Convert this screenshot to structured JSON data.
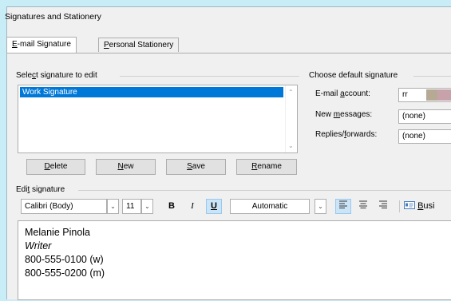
{
  "window": {
    "title": "Signatures and Stationery"
  },
  "tabs": [
    {
      "label": "E-mail Signature",
      "underline": "E",
      "rest": "-mail Signature"
    },
    {
      "label": "Personal Stationery",
      "underline": "P",
      "rest": "ersonal Stationery"
    }
  ],
  "select_section": {
    "label_pre": "Sele",
    "label_u": "c",
    "label_post": "t signature to edit",
    "items": [
      "Work Signature"
    ]
  },
  "buttons": {
    "delete": {
      "u": "D",
      "rest": "elete"
    },
    "new": {
      "u": "N",
      "rest": "ew"
    },
    "save": {
      "u": "S",
      "rest": "ave"
    },
    "rename": {
      "u": "R",
      "rest": "ename"
    }
  },
  "defaults": {
    "header": "Choose default signature",
    "email_label_pre": "E-mail ",
    "email_label_u": "a",
    "email_label_post": "ccount:",
    "email_value": "rr",
    "new_label_pre": "New ",
    "new_label_u": "m",
    "new_label_post": "essages:",
    "new_value": "(none)",
    "replies_label_pre": "Replies/",
    "replies_label_u": "f",
    "replies_label_post": "orwards:",
    "replies_value": "(none)"
  },
  "edit_section": {
    "label_pre": "Edi",
    "label_u": "t",
    "label_post": " signature"
  },
  "toolbar": {
    "font": "Calibri (Body)",
    "size": "11",
    "bold": "B",
    "italic": "I",
    "underline": "U",
    "color": "Automatic",
    "business_u": "B",
    "business_rest": "usi"
  },
  "signature_lines": {
    "name": "Melanie Pinola",
    "title": "Writer",
    "phone_work": "800-555-0100 (w)",
    "phone_mobile": "800-555-0200 (m)"
  },
  "colors": {
    "selection": "#0078d7",
    "toggle_on": "#cce4f7",
    "backdrop": "#c9edf6"
  }
}
